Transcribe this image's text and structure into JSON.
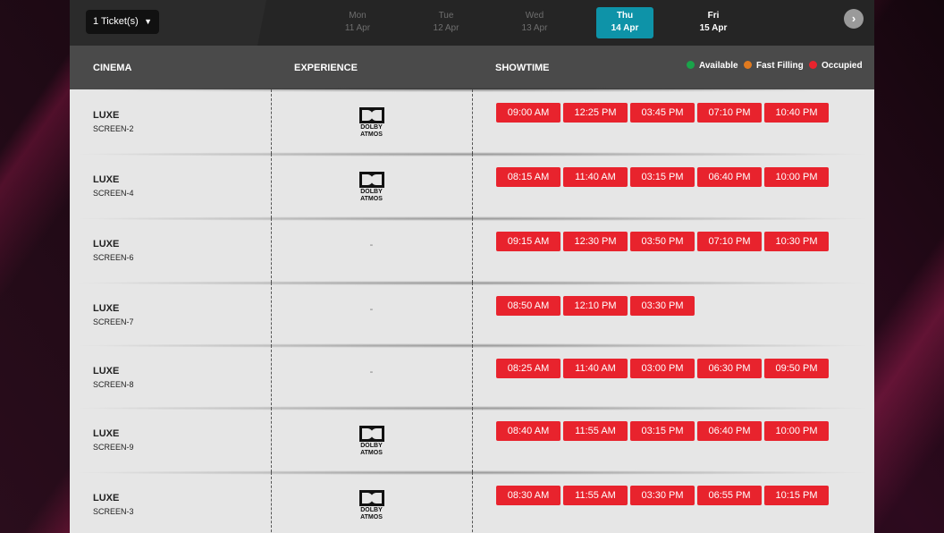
{
  "ticket_selector": {
    "label": "1 Ticket(s)"
  },
  "dates": [
    {
      "dow": "Mon",
      "dm": "11 Apr",
      "state": "inactive"
    },
    {
      "dow": "Tue",
      "dm": "12 Apr",
      "state": "inactive"
    },
    {
      "dow": "Wed",
      "dm": "13 Apr",
      "state": "inactive"
    },
    {
      "dow": "Thu",
      "dm": "14 Apr",
      "state": "active"
    },
    {
      "dow": "Fri",
      "dm": "15 Apr",
      "state": "future"
    }
  ],
  "next_icon": "chevron-right-icon",
  "columns": {
    "cinema": "CINEMA",
    "experience": "EXPERIENCE",
    "showtime": "SHOWTIME"
  },
  "legend": [
    {
      "label": "Available",
      "color": "#1aa34a"
    },
    {
      "label": "Fast Filling",
      "color": "#e07a1f"
    },
    {
      "label": "Occupied",
      "color": "#e8232d"
    }
  ],
  "occupied_color": "#e8232d",
  "rows": [
    {
      "cinema": "LUXE",
      "screen": "SCREEN-2",
      "experience": "DOLBY ATMOS",
      "times": [
        "09:00 AM",
        "12:25 PM",
        "03:45 PM",
        "07:10 PM",
        "10:40 PM"
      ]
    },
    {
      "cinema": "LUXE",
      "screen": "SCREEN-4",
      "experience": "DOLBY ATMOS",
      "times": [
        "08:15 AM",
        "11:40 AM",
        "03:15 PM",
        "06:40 PM",
        "10:00 PM"
      ]
    },
    {
      "cinema": "LUXE",
      "screen": "SCREEN-6",
      "experience": "-",
      "times": [
        "09:15 AM",
        "12:30 PM",
        "03:50 PM",
        "07:10 PM",
        "10:30 PM"
      ]
    },
    {
      "cinema": "LUXE",
      "screen": "SCREEN-7",
      "experience": "-",
      "times": [
        "08:50 AM",
        "12:10 PM",
        "03:30 PM"
      ]
    },
    {
      "cinema": "LUXE",
      "screen": "SCREEN-8",
      "experience": "-",
      "times": [
        "08:25 AM",
        "11:40 AM",
        "03:00 PM",
        "06:30 PM",
        "09:50 PM"
      ]
    },
    {
      "cinema": "LUXE",
      "screen": "SCREEN-9",
      "experience": "DOLBY ATMOS",
      "times": [
        "08:40 AM",
        "11:55 AM",
        "03:15 PM",
        "06:40 PM",
        "10:00 PM"
      ]
    },
    {
      "cinema": "LUXE",
      "screen": "SCREEN-3",
      "experience": "DOLBY ATMOS",
      "times": [
        "08:30 AM",
        "11:55 AM",
        "03:30 PM",
        "06:55 PM",
        "10:15 PM"
      ]
    }
  ]
}
